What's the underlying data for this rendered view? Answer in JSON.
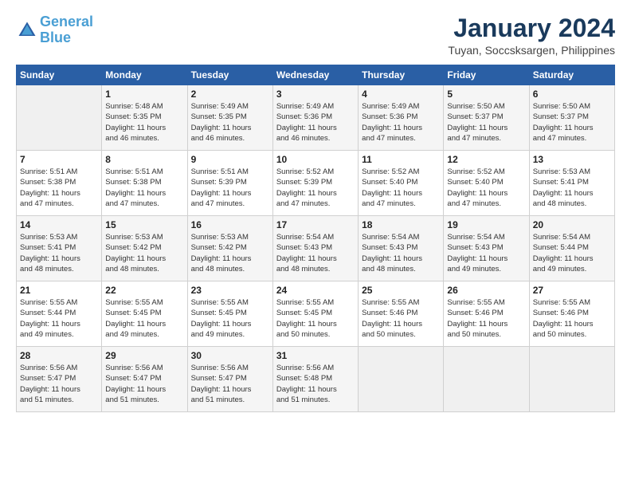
{
  "header": {
    "logo_line1": "General",
    "logo_line2": "Blue",
    "month_title": "January 2024",
    "location": "Tuyan, Soccsksargen, Philippines"
  },
  "weekdays": [
    "Sunday",
    "Monday",
    "Tuesday",
    "Wednesday",
    "Thursday",
    "Friday",
    "Saturday"
  ],
  "weeks": [
    [
      {
        "day": "",
        "info": ""
      },
      {
        "day": "1",
        "info": "Sunrise: 5:48 AM\nSunset: 5:35 PM\nDaylight: 11 hours\nand 46 minutes."
      },
      {
        "day": "2",
        "info": "Sunrise: 5:49 AM\nSunset: 5:35 PM\nDaylight: 11 hours\nand 46 minutes."
      },
      {
        "day": "3",
        "info": "Sunrise: 5:49 AM\nSunset: 5:36 PM\nDaylight: 11 hours\nand 46 minutes."
      },
      {
        "day": "4",
        "info": "Sunrise: 5:49 AM\nSunset: 5:36 PM\nDaylight: 11 hours\nand 47 minutes."
      },
      {
        "day": "5",
        "info": "Sunrise: 5:50 AM\nSunset: 5:37 PM\nDaylight: 11 hours\nand 47 minutes."
      },
      {
        "day": "6",
        "info": "Sunrise: 5:50 AM\nSunset: 5:37 PM\nDaylight: 11 hours\nand 47 minutes."
      }
    ],
    [
      {
        "day": "7",
        "info": "Sunrise: 5:51 AM\nSunset: 5:38 PM\nDaylight: 11 hours\nand 47 minutes."
      },
      {
        "day": "8",
        "info": "Sunrise: 5:51 AM\nSunset: 5:38 PM\nDaylight: 11 hours\nand 47 minutes."
      },
      {
        "day": "9",
        "info": "Sunrise: 5:51 AM\nSunset: 5:39 PM\nDaylight: 11 hours\nand 47 minutes."
      },
      {
        "day": "10",
        "info": "Sunrise: 5:52 AM\nSunset: 5:39 PM\nDaylight: 11 hours\nand 47 minutes."
      },
      {
        "day": "11",
        "info": "Sunrise: 5:52 AM\nSunset: 5:40 PM\nDaylight: 11 hours\nand 47 minutes."
      },
      {
        "day": "12",
        "info": "Sunrise: 5:52 AM\nSunset: 5:40 PM\nDaylight: 11 hours\nand 47 minutes."
      },
      {
        "day": "13",
        "info": "Sunrise: 5:53 AM\nSunset: 5:41 PM\nDaylight: 11 hours\nand 48 minutes."
      }
    ],
    [
      {
        "day": "14",
        "info": "Sunrise: 5:53 AM\nSunset: 5:41 PM\nDaylight: 11 hours\nand 48 minutes."
      },
      {
        "day": "15",
        "info": "Sunrise: 5:53 AM\nSunset: 5:42 PM\nDaylight: 11 hours\nand 48 minutes."
      },
      {
        "day": "16",
        "info": "Sunrise: 5:53 AM\nSunset: 5:42 PM\nDaylight: 11 hours\nand 48 minutes."
      },
      {
        "day": "17",
        "info": "Sunrise: 5:54 AM\nSunset: 5:43 PM\nDaylight: 11 hours\nand 48 minutes."
      },
      {
        "day": "18",
        "info": "Sunrise: 5:54 AM\nSunset: 5:43 PM\nDaylight: 11 hours\nand 48 minutes."
      },
      {
        "day": "19",
        "info": "Sunrise: 5:54 AM\nSunset: 5:43 PM\nDaylight: 11 hours\nand 49 minutes."
      },
      {
        "day": "20",
        "info": "Sunrise: 5:54 AM\nSunset: 5:44 PM\nDaylight: 11 hours\nand 49 minutes."
      }
    ],
    [
      {
        "day": "21",
        "info": "Sunrise: 5:55 AM\nSunset: 5:44 PM\nDaylight: 11 hours\nand 49 minutes."
      },
      {
        "day": "22",
        "info": "Sunrise: 5:55 AM\nSunset: 5:45 PM\nDaylight: 11 hours\nand 49 minutes."
      },
      {
        "day": "23",
        "info": "Sunrise: 5:55 AM\nSunset: 5:45 PM\nDaylight: 11 hours\nand 49 minutes."
      },
      {
        "day": "24",
        "info": "Sunrise: 5:55 AM\nSunset: 5:45 PM\nDaylight: 11 hours\nand 50 minutes."
      },
      {
        "day": "25",
        "info": "Sunrise: 5:55 AM\nSunset: 5:46 PM\nDaylight: 11 hours\nand 50 minutes."
      },
      {
        "day": "26",
        "info": "Sunrise: 5:55 AM\nSunset: 5:46 PM\nDaylight: 11 hours\nand 50 minutes."
      },
      {
        "day": "27",
        "info": "Sunrise: 5:55 AM\nSunset: 5:46 PM\nDaylight: 11 hours\nand 50 minutes."
      }
    ],
    [
      {
        "day": "28",
        "info": "Sunrise: 5:56 AM\nSunset: 5:47 PM\nDaylight: 11 hours\nand 51 minutes."
      },
      {
        "day": "29",
        "info": "Sunrise: 5:56 AM\nSunset: 5:47 PM\nDaylight: 11 hours\nand 51 minutes."
      },
      {
        "day": "30",
        "info": "Sunrise: 5:56 AM\nSunset: 5:47 PM\nDaylight: 11 hours\nand 51 minutes."
      },
      {
        "day": "31",
        "info": "Sunrise: 5:56 AM\nSunset: 5:48 PM\nDaylight: 11 hours\nand 51 minutes."
      },
      {
        "day": "",
        "info": ""
      },
      {
        "day": "",
        "info": ""
      },
      {
        "day": "",
        "info": ""
      }
    ]
  ]
}
